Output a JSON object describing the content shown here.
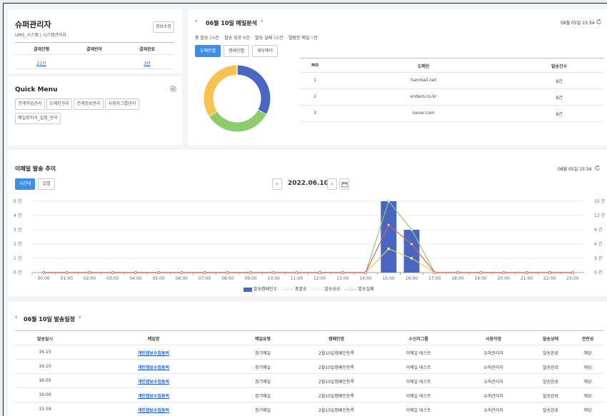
{
  "admin": {
    "title": "슈퍼관리자",
    "subtitle": "UMS_시스템 | 시스템관리자",
    "edit_button": "정보수정",
    "approval_headers": [
      "결재진행",
      "결재반려",
      "결재완료"
    ],
    "approval_values": [
      "21건",
      "",
      "3건"
    ]
  },
  "quick_menu": {
    "title": "Quick Menu",
    "items": [
      "연계작업관리",
      "도메인관리",
      "연계정보관리",
      "사용자그룹관리",
      "메일용지식_일정_관리"
    ]
  },
  "analysis": {
    "date_title": "06월 10일 메일분석",
    "timestamp": "08월 05일 15:34",
    "stats": {
      "total_label": "총 발송",
      "total_value": "24",
      "success_label": "발송 성공",
      "success_value": "8",
      "fail_label": "발송 실패",
      "fail_value": "16",
      "open_label": "열람한 메일",
      "open_value": "0",
      "unit": "건"
    },
    "tabs": [
      "도메인별",
      "캠페인별",
      "세부에러"
    ],
    "donut": [
      {
        "label": "navy",
        "value": 33,
        "color": "#4a66c3"
      },
      {
        "label": "green",
        "value": 33,
        "color": "#8ccc6a"
      },
      {
        "label": "yellow",
        "value": 34,
        "color": "#f6c350"
      }
    ],
    "table_headers": [
      "NO",
      "도메인",
      "발송건수"
    ],
    "table_rows": [
      [
        "1",
        "hanmail.net",
        "8건"
      ],
      [
        "2",
        "enders.co.kr",
        "8건"
      ],
      [
        "3",
        "naver.com",
        "8건"
      ]
    ]
  },
  "trend": {
    "title": "이메일 발송 추이",
    "timestamp": "08월 05일 15:34",
    "tabs": [
      "시간대",
      "일별"
    ],
    "date": "2022.06.10",
    "legend": [
      "발송캠페인수",
      "총발송",
      "발송성공",
      "발송실패"
    ]
  },
  "chart_data": {
    "type": "bar",
    "categories": [
      "00:00",
      "01:00",
      "02:00",
      "03:00",
      "04:00",
      "05:00",
      "06:00",
      "07:00",
      "08:00",
      "09:00",
      "10:00",
      "11:00",
      "12:00",
      "13:00",
      "14:00",
      "15:00",
      "16:00",
      "17:00",
      "18:00",
      "19:00",
      "20:00",
      "21:00",
      "22:00",
      "23:00"
    ],
    "left_axis": {
      "ticks": [
        "0 건",
        "1 건",
        "2 건",
        "3 건",
        "4 건",
        "5 건"
      ],
      "ylim": [
        0,
        5
      ]
    },
    "right_axis": {
      "ticks": [
        "0 건",
        "3 건",
        "6 건",
        "9 건",
        "12 건",
        "15 건"
      ],
      "ylim": [
        0,
        15
      ]
    },
    "series": [
      {
        "name": "발송캠페인수",
        "type": "bar",
        "axis": "left",
        "color": "#4a66c3",
        "values": [
          0,
          0,
          0,
          0,
          0,
          0,
          0,
          0,
          0,
          0,
          0,
          0,
          0,
          0,
          0,
          5,
          3,
          0,
          0,
          0,
          0,
          0,
          0,
          0
        ]
      },
      {
        "name": "총발송",
        "type": "line",
        "axis": "right",
        "color": "#8ccc6a",
        "values": [
          0,
          0,
          0,
          0,
          0,
          0,
          0,
          0,
          0,
          0,
          0,
          0,
          0,
          0,
          0,
          15,
          9,
          0,
          0,
          0,
          0,
          0,
          0,
          0
        ]
      },
      {
        "name": "발송성공",
        "type": "line",
        "axis": "right",
        "color": "#f6c350",
        "values": [
          0,
          0,
          0,
          0,
          0,
          0,
          0,
          0,
          0,
          0,
          0,
          0,
          0,
          0,
          0,
          5,
          3,
          0,
          0,
          0,
          0,
          0,
          0,
          0
        ]
      },
      {
        "name": "발송실패",
        "type": "line",
        "axis": "right",
        "color": "#e2615a",
        "values": [
          0,
          0,
          0,
          0,
          0,
          0,
          0,
          0,
          0,
          0,
          0,
          0,
          0,
          0,
          0,
          10,
          6,
          0,
          0,
          0,
          0,
          0,
          0,
          0
        ]
      }
    ],
    "grid": true,
    "legend_position": "bottom"
  },
  "schedule": {
    "title": "06월 10일 발송일정",
    "headers": [
      "발송일시",
      "메일명",
      "메일유형",
      "캠페인명",
      "수신자그룹",
      "사용자명",
      "발송상태",
      "관련성"
    ],
    "rows": [
      [
        "16:15",
        "개인정보수집동의",
        "정기메일",
        "2월10일캠페인등록",
        "이메일 테스트",
        "슈퍼관리자",
        "발송완료",
        "해당"
      ],
      [
        "16:10",
        "개인정보수집동의",
        "정기메일",
        "2월10일캠페인등록",
        "이메일 테스트",
        "슈퍼관리자",
        "발송완료",
        "해당"
      ],
      [
        "16:05",
        "개인정보수집동의",
        "정기메일",
        "2월10일캠페인등록",
        "이메일 테스트",
        "슈퍼관리자",
        "발송완료",
        "해당"
      ],
      [
        "16:00",
        "개인정보수집동의",
        "정기메일",
        "2월10일캠페인등록",
        "이메일 테스트",
        "슈퍼관리자",
        "발송완료",
        "해당"
      ],
      [
        "15:59",
        "개인정보수집동의",
        "정기메일",
        "2월10일캠페인등록",
        "이메일 테스트",
        "슈퍼관리자",
        "발송완료",
        "해당"
      ]
    ]
  }
}
